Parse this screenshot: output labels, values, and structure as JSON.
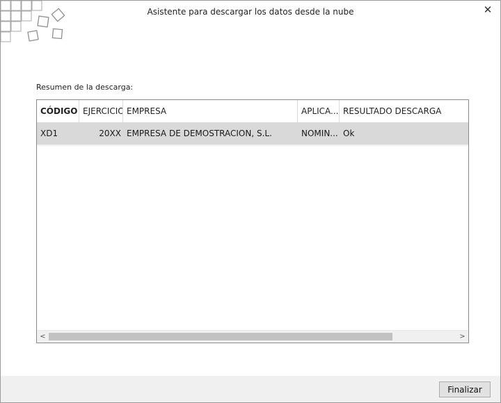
{
  "window": {
    "title": "Asistente para descargar los datos desde la nube",
    "close_glyph": "✕"
  },
  "summary_label": "Resumen de la descarga:",
  "table": {
    "columns": [
      "CÓDIGO",
      "EJERCICIO",
      "EMPRESA",
      "APLICA...",
      "RESULTADO DESCARGA"
    ],
    "rows": [
      {
        "codigo": "XD1",
        "ejercicio": "20XX",
        "empresa": "EMPRESA DE DEMOSTRACION, S.L.",
        "aplicacion": "NOMIN...",
        "resultado": "Ok"
      }
    ]
  },
  "scrollbar": {
    "left_arrow": "<",
    "right_arrow": ">"
  },
  "footer": {
    "finalizar_label": "Finalizar"
  },
  "colors": {
    "row_selected": "#d9d9d9",
    "footer_bg": "#f0f0f0",
    "logo_stroke": "#a0a0a0"
  },
  "icons": {
    "logo": "checker-cubes-logo-icon",
    "close": "close-icon"
  }
}
